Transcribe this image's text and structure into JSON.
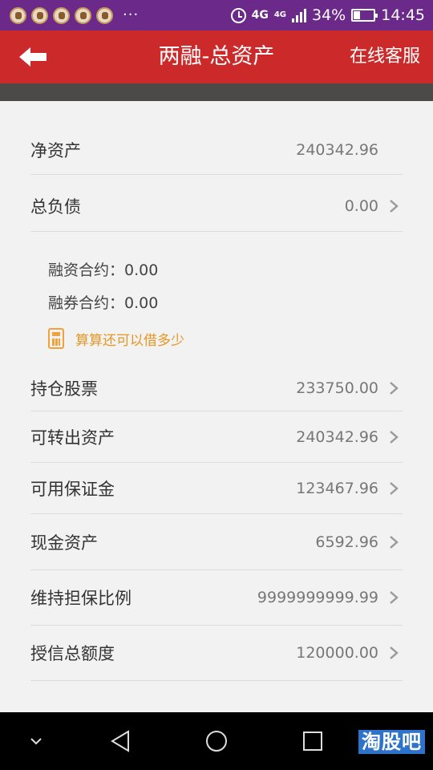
{
  "status_bar": {
    "network": "4G",
    "network2": "4G",
    "battery_percent": "34%",
    "battery_level": 0.34,
    "time": "14:45",
    "more": "···"
  },
  "header": {
    "title": "两融-总资产",
    "service_label": "在线客服",
    "bg_color": "#cc2a2a"
  },
  "rows": {
    "net_assets": {
      "label": "净资产",
      "value": "240342.96"
    },
    "total_liabilities": {
      "label": "总负债",
      "value": "0.00"
    },
    "positions": {
      "label": "持仓股票",
      "value": "233750.00"
    },
    "transferable": {
      "label": "可转出资产",
      "value": "240342.96"
    },
    "available_margin": {
      "label": "可用保证金",
      "value": "123467.96"
    },
    "cash_assets": {
      "label": "现金资产",
      "value": "6592.96"
    },
    "maintenance_ratio": {
      "label": "维持担保比例",
      "value": "9999999999.99"
    },
    "credit_limit": {
      "label": "授信总额度",
      "value": "120000.00"
    }
  },
  "liability_detail": {
    "financing_contract": "融资合约：0.00",
    "securities_contract": "融券合约：0.00"
  },
  "calculator": {
    "label": "算算还可以借多少",
    "color": "#e79622"
  },
  "watermark": "淘股吧"
}
